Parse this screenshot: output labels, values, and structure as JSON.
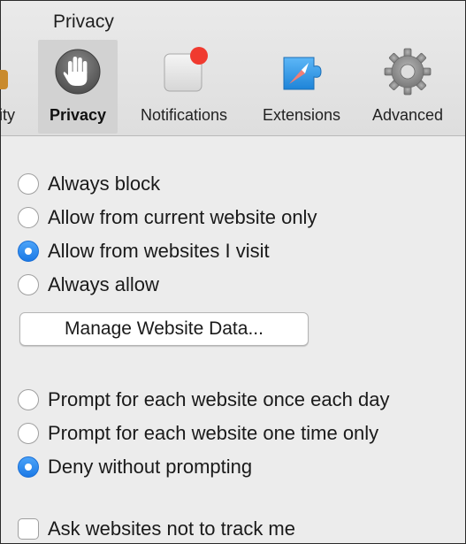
{
  "window": {
    "title": "Privacy"
  },
  "tabs": [
    {
      "label": "ity",
      "icon": "partial-tab-icon",
      "selected": false
    },
    {
      "label": "Privacy",
      "icon": "hand-stop-icon",
      "selected": true
    },
    {
      "label": "Notifications",
      "icon": "notifications-icon",
      "selected": false
    },
    {
      "label": "Extensions",
      "icon": "compass-puzzle-icon",
      "selected": false
    },
    {
      "label": "Advanced",
      "icon": "gear-icon",
      "selected": false
    }
  ],
  "cookies": {
    "options": [
      {
        "label": "Always block",
        "checked": false
      },
      {
        "label": "Allow from current website only",
        "checked": false
      },
      {
        "label": "Allow from websites I visit",
        "checked": true
      },
      {
        "label": "Always allow",
        "checked": false
      }
    ],
    "manage_button_label": "Manage Website Data..."
  },
  "location": {
    "options": [
      {
        "label": "Prompt for each website once each day",
        "checked": false
      },
      {
        "label": "Prompt for each website one time only",
        "checked": false
      },
      {
        "label": "Deny without prompting",
        "checked": true
      }
    ]
  },
  "tracking": {
    "label": "Ask websites not to track me",
    "checked": false
  },
  "colors": {
    "accent": "#1b79e6",
    "notification_badge": "#f03a2f",
    "background": "#ececec"
  }
}
